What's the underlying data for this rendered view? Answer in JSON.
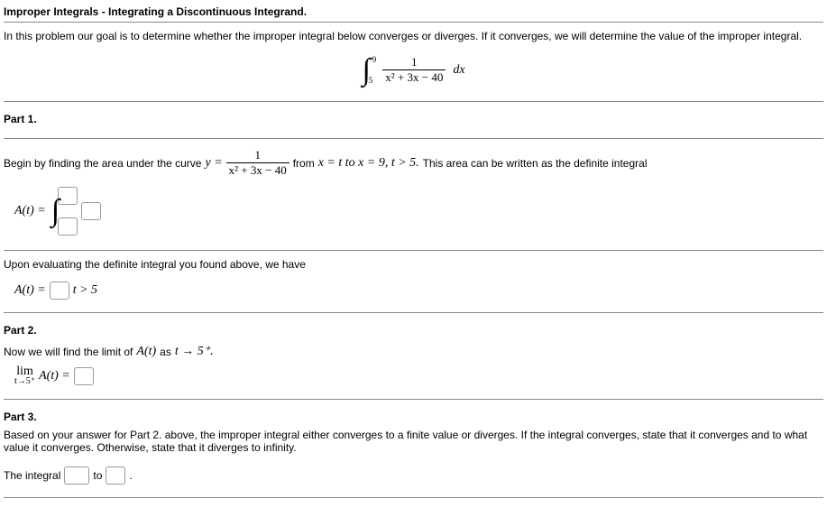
{
  "title": "Improper Integrals - Integrating a Discontinuous Integrand.",
  "intro": "In this problem our goal is to determine whether the improper integral below converges or diverges. If it converges, we will determine the value of the improper integral.",
  "main_integral": {
    "lower": "5",
    "upper": "9",
    "num": "1",
    "den": "x² + 3x − 40",
    "dx": "dx"
  },
  "part1": {
    "label": "Part 1.",
    "text_a": "Begin by finding the area under the curve ",
    "y_eq": "y =",
    "frac_num": "1",
    "frac_den": "x² + 3x − 40",
    "text_b": " from ",
    "cond": "x = t to x = 9, t > 5.",
    "text_c": " This area can be written as the definite integral",
    "A_of_t": "A(t) =",
    "eval_text": "Upon evaluating the definite integral you found above, we have",
    "eval_At": "A(t) =",
    "eval_suffix": "t > 5"
  },
  "part2": {
    "label": "Part 2.",
    "text": "Now we will find the limit of ",
    "at": "A(t)",
    "text2": " as ",
    "lim_cond": "t → 5⁺.",
    "lim_top": "lim",
    "lim_bot": "t→5⁺",
    "lim_rhs": "A(t) ="
  },
  "part3": {
    "label": "Part 3.",
    "text": "Based on your answer for Part 2. above, the improper integral either converges to a finite value or diverges. If the integral converges, state that it converges and to what value it converges. Otherwise, state that it diverges to infinity.",
    "sentence_a": "The integral ",
    "sentence_b": " to ",
    "sentence_c": "."
  }
}
